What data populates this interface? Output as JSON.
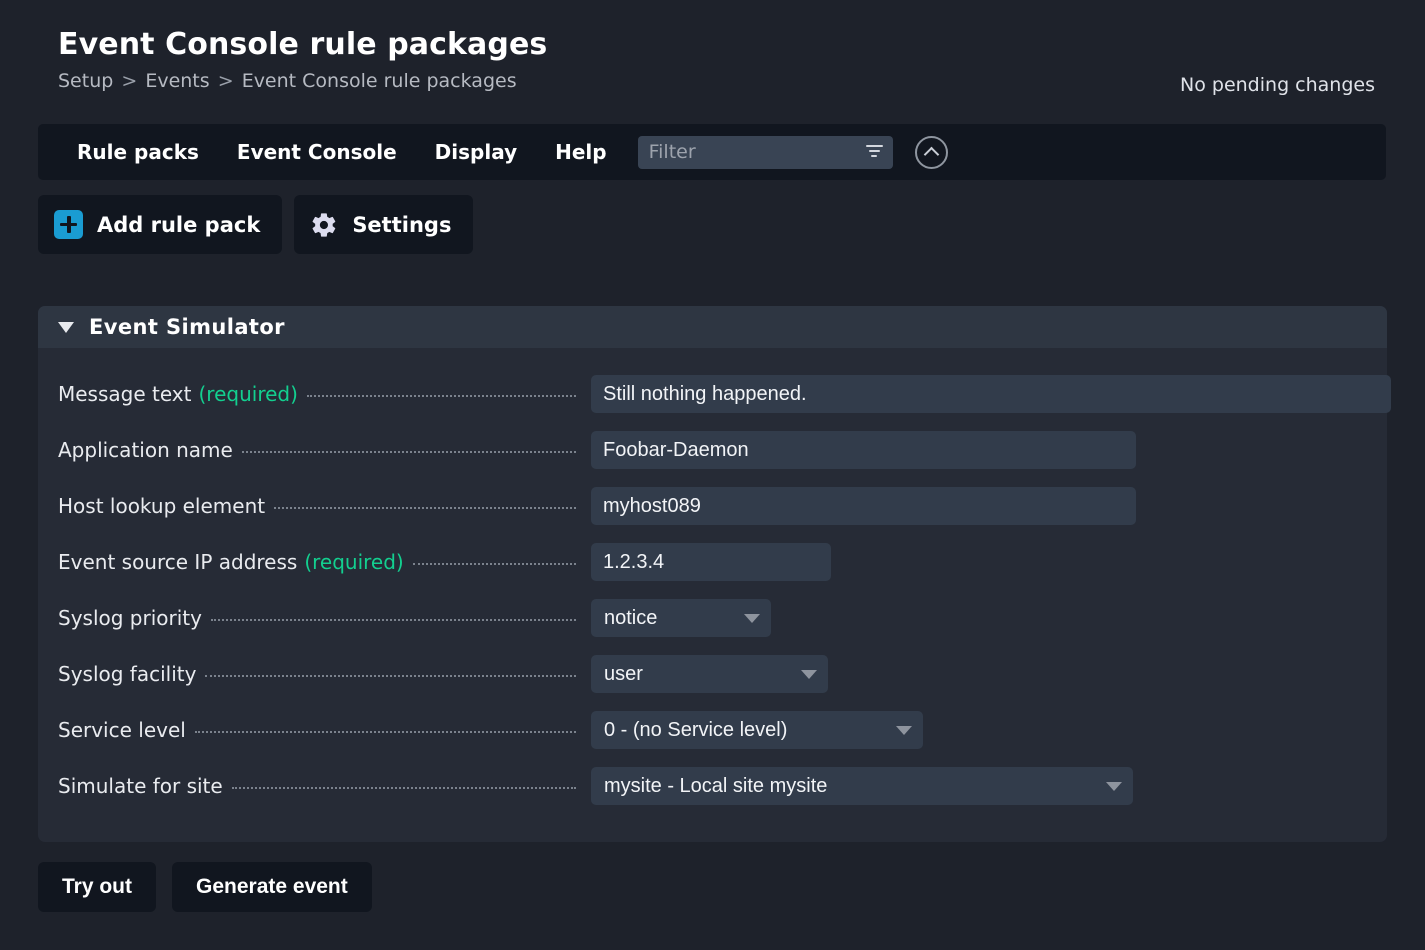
{
  "header": {
    "title": "Event Console rule packages",
    "breadcrumb": [
      "Setup",
      "Events",
      "Event Console rule packages"
    ],
    "breadcrumb_separator": ">",
    "pending_changes": "No pending changes"
  },
  "navbar": {
    "items": [
      {
        "label": "Rule packs"
      },
      {
        "label": "Event Console"
      },
      {
        "label": "Display"
      },
      {
        "label": "Help"
      }
    ],
    "filter": {
      "value": "",
      "placeholder": "Filter",
      "icon": "filter-funnel-icon"
    },
    "collapse": {
      "icon": "chevron-up-circle-icon"
    }
  },
  "toolbar": {
    "add_rule_pack_label": "Add rule pack",
    "add_rule_pack_icon": "plus-icon",
    "settings_label": "Settings",
    "settings_icon": "gear-icon"
  },
  "simulator": {
    "title": "Event Simulator",
    "toggle_icon": "triangle-down-icon",
    "required_suffix": "(required)",
    "fields": [
      {
        "label": "Message text",
        "required": true,
        "type": "text",
        "value": "Still nothing happened."
      },
      {
        "label": "Application name",
        "required": false,
        "type": "text",
        "value": "Foobar-Daemon"
      },
      {
        "label": "Host lookup element",
        "required": false,
        "type": "text",
        "value": "myhost089"
      },
      {
        "label": "Event source IP address",
        "required": true,
        "type": "text",
        "value": "1.2.3.4"
      },
      {
        "label": "Syslog priority",
        "required": false,
        "type": "select",
        "value": "notice"
      },
      {
        "label": "Syslog facility",
        "required": false,
        "type": "select",
        "value": "user"
      },
      {
        "label": "Service level",
        "required": false,
        "type": "select",
        "value": "0 - (no Service level)"
      },
      {
        "label": "Simulate for site",
        "required": false,
        "type": "select",
        "value": "mysite - Local site mysite"
      }
    ]
  },
  "footer": {
    "try_out_label": "Try out",
    "generate_event_label": "Generate event"
  },
  "colors": {
    "page_background": "#1e222b",
    "nav_background": "#11161f",
    "card_background": "#262b36",
    "card_header_background": "#2e3642",
    "input_background": "#323c4b",
    "accent_blue": "#1a9cd2",
    "required_green": "#13cf8f",
    "gear_lavender": "#dcdcee"
  }
}
